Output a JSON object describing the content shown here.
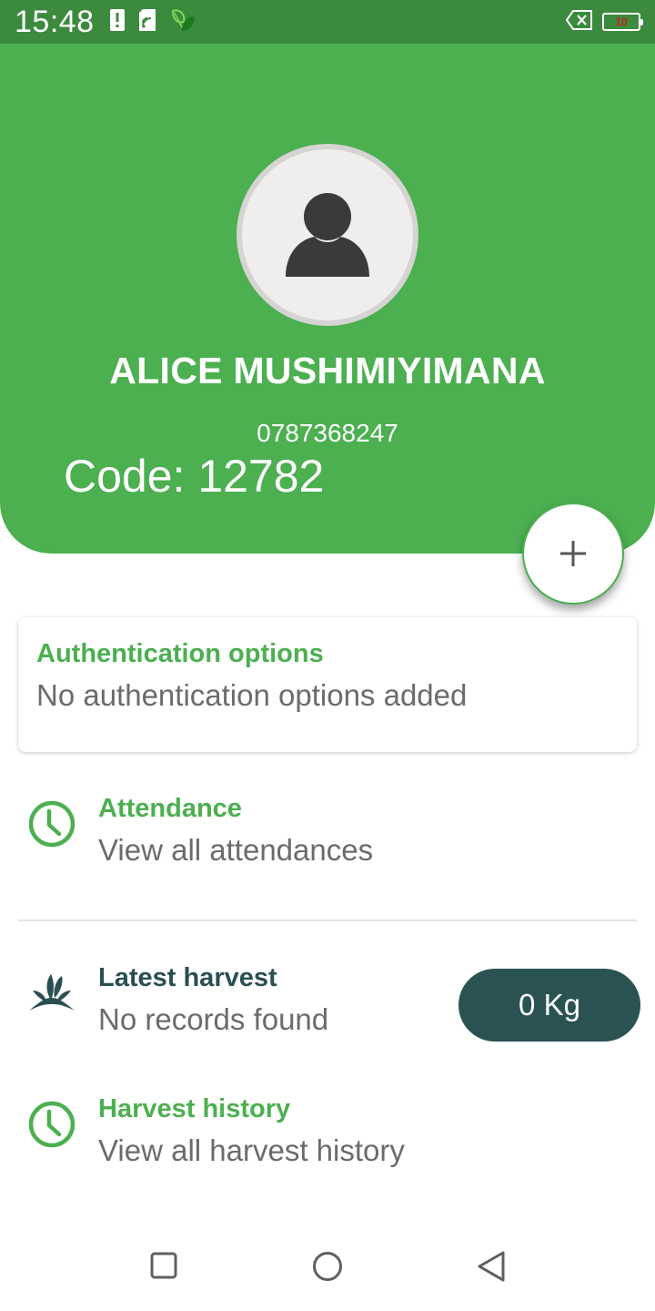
{
  "status_bar": {
    "time": "15:48",
    "battery_level": "10",
    "icons": [
      "alert-icon",
      "sim-card-icon",
      "leaf-app-icon",
      "no-sim-icon",
      "battery-icon"
    ]
  },
  "profile": {
    "name": "ALICE MUSHIMIYIMANA",
    "phone": "0787368247",
    "code_text": "Code: 12782",
    "avatar_icon": "person-icon"
  },
  "fab": {
    "icon": "plus-icon"
  },
  "auth_card": {
    "title": "Authentication options",
    "subtitle": "No authentication options added"
  },
  "attendance": {
    "title": "Attendance",
    "subtitle": "View all attendances",
    "icon": "clock-icon"
  },
  "latest_harvest": {
    "title": "Latest harvest",
    "subtitle": "No records found",
    "icon": "crop-icon",
    "amount": "0 Kg"
  },
  "harvest_history": {
    "title": "Harvest history",
    "subtitle": "View all harvest history",
    "icon": "clock-icon"
  },
  "colors": {
    "primary_green": "#4caf50",
    "status_green": "#3c8a3e",
    "dark_teal": "#2a5253",
    "grey_text": "#6b6b6b"
  },
  "nav_bar": {
    "buttons": [
      "recents-square-icon",
      "home-circle-icon",
      "back-triangle-icon"
    ]
  }
}
